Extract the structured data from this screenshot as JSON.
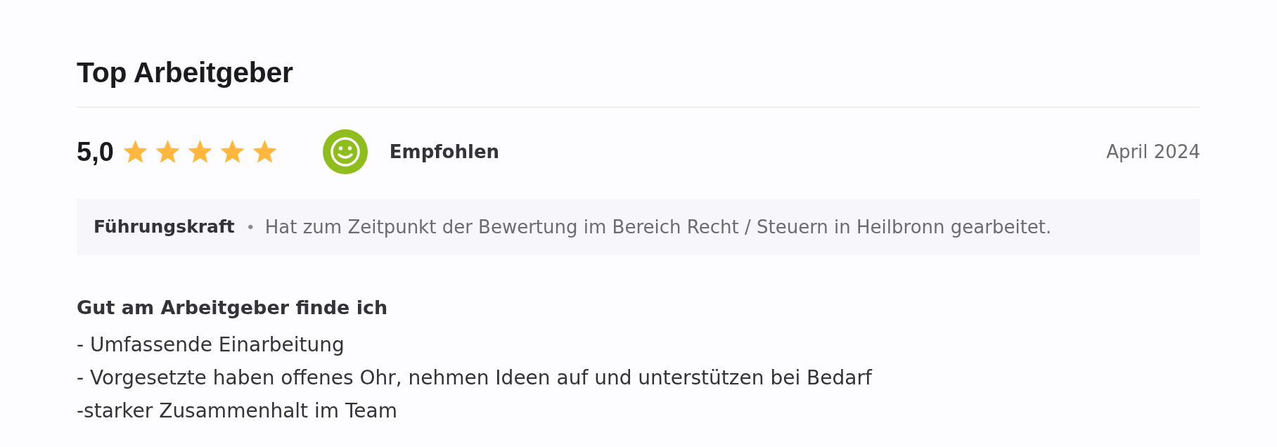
{
  "section": {
    "title": "Top Arbeitgeber"
  },
  "review": {
    "score": "5,0",
    "stars": 5,
    "recommendation": {
      "label": "Empfohlen",
      "recommended": true
    },
    "date": "April 2024"
  },
  "reviewer": {
    "role": "Führungskraft",
    "separator": "•",
    "description": "Hat zum Zeitpunkt der Bewertung im Bereich Recht / Steuern in Heilbronn gearbeitet."
  },
  "pros": {
    "heading": "Gut am Arbeitgeber finde ich",
    "lines": [
      "- Umfassende Einarbeitung",
      "- Vorgesetzte haben offenes Ohr, nehmen Ideen auf und unterstützen bei Bedarf",
      "-starker Zusammenhalt im Team"
    ]
  }
}
